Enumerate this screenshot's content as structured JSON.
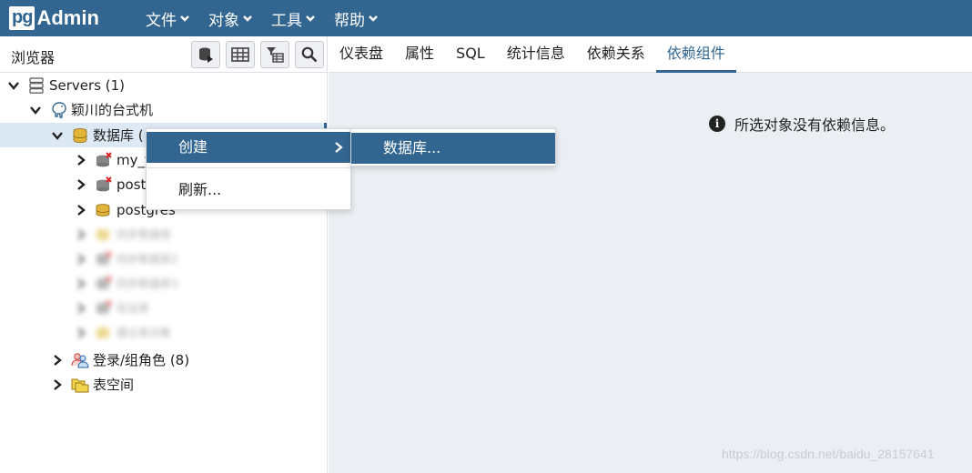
{
  "app": {
    "logo_pg": "pg",
    "logo_admin": "Admin"
  },
  "menu": [
    {
      "label": "文件"
    },
    {
      "label": "对象"
    },
    {
      "label": "工具"
    },
    {
      "label": "帮助"
    }
  ],
  "browser": {
    "title": "浏览器",
    "toolbar": [
      "query-tool-icon",
      "view-data-icon",
      "filtered-rows-icon",
      "search-icon"
    ]
  },
  "tree": {
    "servers": "Servers (1)",
    "server": "颖川的台式机",
    "databases": "数据库 (",
    "db1": "my_t",
    "db2": "post",
    "db3": "postgres",
    "blurred": [
      "同步数据库",
      "同步数据库2",
      "同步数据库3",
      "验证库",
      "建立库对象"
    ],
    "login_roles": "登录/组角色 (8)",
    "tablespaces": "表空间"
  },
  "tabs": [
    {
      "label": "仪表盘"
    },
    {
      "label": "属性"
    },
    {
      "label": "SQL"
    },
    {
      "label": "统计信息"
    },
    {
      "label": "依赖关系"
    },
    {
      "label": "依赖组件"
    }
  ],
  "active_tab": "依赖组件",
  "info_message": "所选对象没有依赖信息。",
  "context_menu": {
    "create": "创建",
    "refresh": "刷新..."
  },
  "submenu": {
    "database": "数据库..."
  },
  "watermark": "https://blog.csdn.net/baidu_28157641",
  "colors": {
    "primary": "#326690",
    "panel_bg": "#ebeef3",
    "selected_bg": "#dce9f5"
  }
}
